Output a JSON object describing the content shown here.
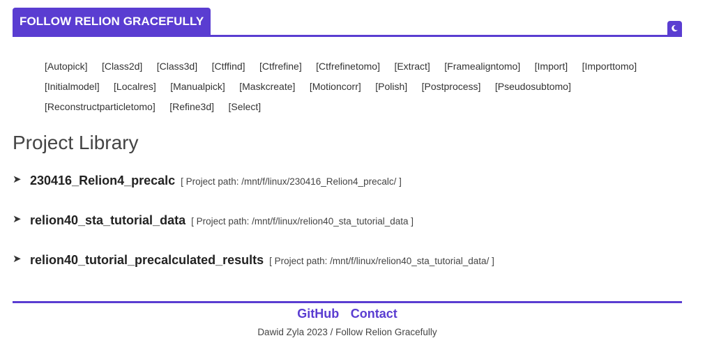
{
  "header": {
    "brand": "FOLLOW RELION GRACEFULLY",
    "theme_icon": "moon-icon"
  },
  "colors": {
    "accent": "#5a3dd1",
    "text": "#333333"
  },
  "nav": {
    "tags": [
      "[Autopick]",
      "[Class2d]",
      "[Class3d]",
      "[Ctffind]",
      "[Ctfrefine]",
      "[Ctfrefinetomo]",
      "[Extract]",
      "[Framealigntomo]",
      "[Import]",
      "[Importtomo]",
      "[Initialmodel]",
      "[Localres]",
      "[Manualpick]",
      "[Maskcreate]",
      "[Motioncorr]",
      "[Polish]",
      "[Postprocess]",
      "[Pseudosubtomo]",
      "[Reconstructparticletomo]",
      "[Refine3d]",
      "[Select]"
    ]
  },
  "library": {
    "title": "Project Library",
    "projects": [
      {
        "name": "230416_Relion4_precalc",
        "path": "[ Project path: /mnt/f/linux/230416_Relion4_precalc/ ]"
      },
      {
        "name": "relion40_sta_tutorial_data",
        "path": "[ Project path: /mnt/f/linux/relion40_sta_tutorial_data ]"
      },
      {
        "name": "relion40_tutorial_precalculated_results",
        "path": "[ Project path: /mnt/f/linux/relion40_sta_tutorial_data/ ]"
      }
    ]
  },
  "footer": {
    "github": "GitHub",
    "contact": "Contact",
    "credit": "Dawid Zyla 2023 / Follow Relion Gracefully"
  }
}
